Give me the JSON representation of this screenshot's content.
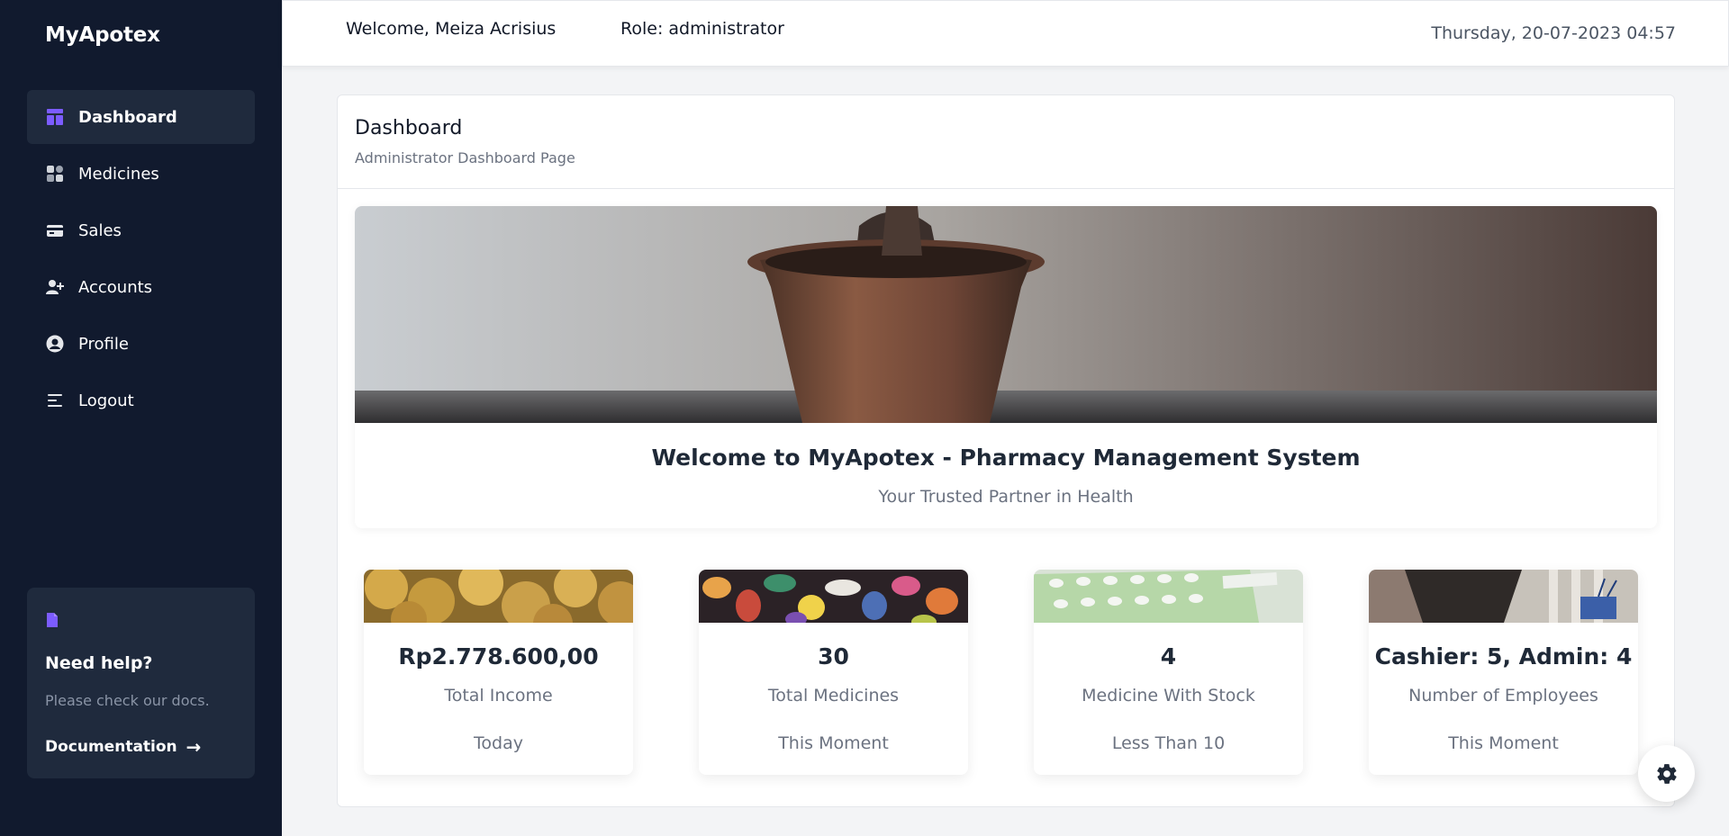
{
  "app": {
    "brand": "MyApotex"
  },
  "sidebar": {
    "items": [
      {
        "label": "Dashboard",
        "icon": "dashboard-icon",
        "active": true
      },
      {
        "label": "Medicines",
        "icon": "grid-icon"
      },
      {
        "label": "Sales",
        "icon": "credit-card-icon"
      },
      {
        "label": "Accounts",
        "icon": "user-add-icon"
      },
      {
        "label": "Profile",
        "icon": "user-circle-icon"
      },
      {
        "label": "Logout",
        "icon": "menu-lines-icon"
      }
    ],
    "help": {
      "icon": "document-icon",
      "title": "Need help?",
      "subtitle": "Please check our docs.",
      "link_label": "Documentation",
      "link_icon": "arrow-right-icon"
    }
  },
  "header": {
    "welcome": "Welcome, Meiza Acrisius",
    "role": "Role: administrator",
    "datetime": "Thursday, 20-07-2023 04:57"
  },
  "main": {
    "title": "Dashboard",
    "subtitle": "Administrator Dashboard Page",
    "hero": {
      "title": "Welcome to MyApotex - Pharmacy Management System",
      "subtitle": "Your Trusted Partner in Health"
    },
    "stats": [
      {
        "value": "Rp2.778.600,00",
        "label": "Total Income",
        "period": "Today",
        "image": "coins-image"
      },
      {
        "value": "30",
        "label": "Total Medicines",
        "period": "This Moment",
        "image": "pills-image"
      },
      {
        "value": "4",
        "label": "Medicine With Stock",
        "period": "Less Than 10",
        "image": "blister-pack-image"
      },
      {
        "value": "Cashier: 5, Admin: 4",
        "label": "Number of Employees",
        "period": "This Moment",
        "image": "pharmacist-image"
      }
    ]
  },
  "colors": {
    "sidebar_bg": "#111a2e",
    "sidebar_active": "#1f2a3d",
    "accent_icon": "#7c5cff"
  }
}
